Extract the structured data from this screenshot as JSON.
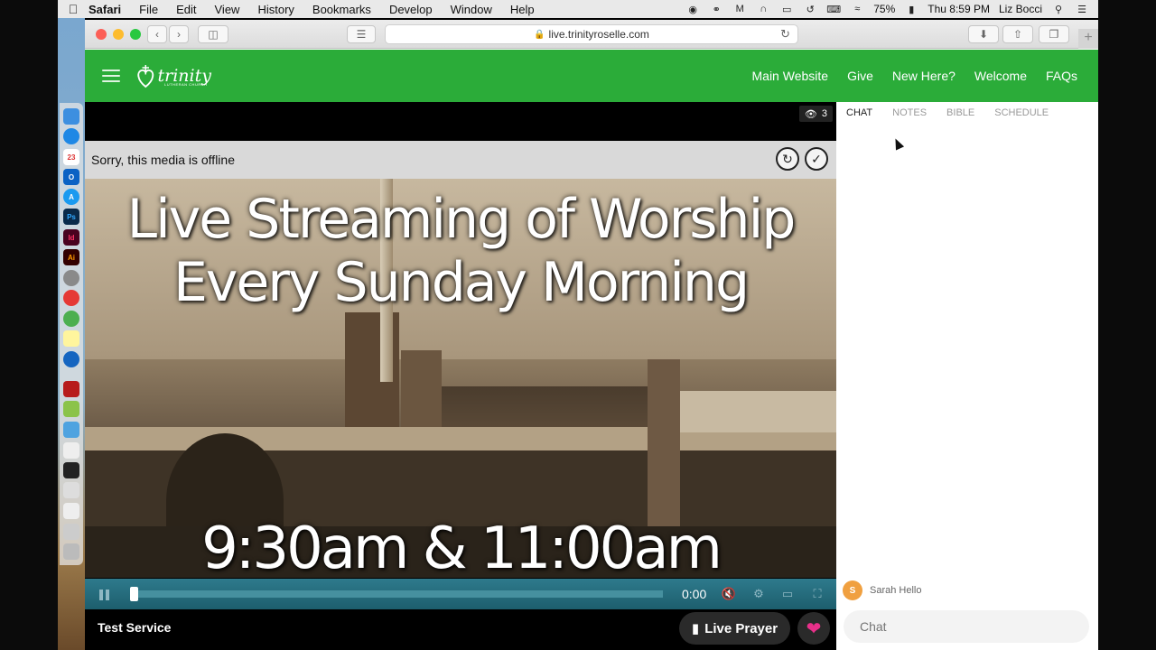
{
  "menubar": {
    "apple": "",
    "items": [
      "Safari",
      "File",
      "Edit",
      "View",
      "History",
      "Bookmarks",
      "Develop",
      "Window",
      "Help"
    ],
    "battery": "75%",
    "clock": "Thu 8:59 PM",
    "user": "Liz Bocci"
  },
  "browser": {
    "url": "live.trinityroselle.com"
  },
  "site": {
    "logo_text": "trinity",
    "logo_sub": "LUTHERAN CHURCH",
    "nav": [
      "Main Website",
      "Give",
      "New Here?",
      "Welcome",
      "FAQs"
    ]
  },
  "video": {
    "viewer_count": "3",
    "offline_message": "Sorry, this media is offline",
    "poster_line1": "Live Streaming of Worship",
    "poster_line2": "Every Sunday Morning",
    "poster_times": "9:30am & 11:00am",
    "time": "0:00",
    "progress_fraction": 0.0,
    "service_title": "Test Service",
    "live_prayer_label": "Live Prayer"
  },
  "chat": {
    "tabs": [
      "CHAT",
      "NOTES",
      "BIBLE",
      "SCHEDULE"
    ],
    "active_tab": "CHAT",
    "messages": [
      {
        "avatar_letter": "S",
        "author": "Sarah",
        "text": "Hello"
      }
    ],
    "input_placeholder": "Chat"
  },
  "colors": {
    "brand_green": "#2bac39",
    "heart": "#e8308a",
    "controls_teal": "#1d5e6d"
  }
}
